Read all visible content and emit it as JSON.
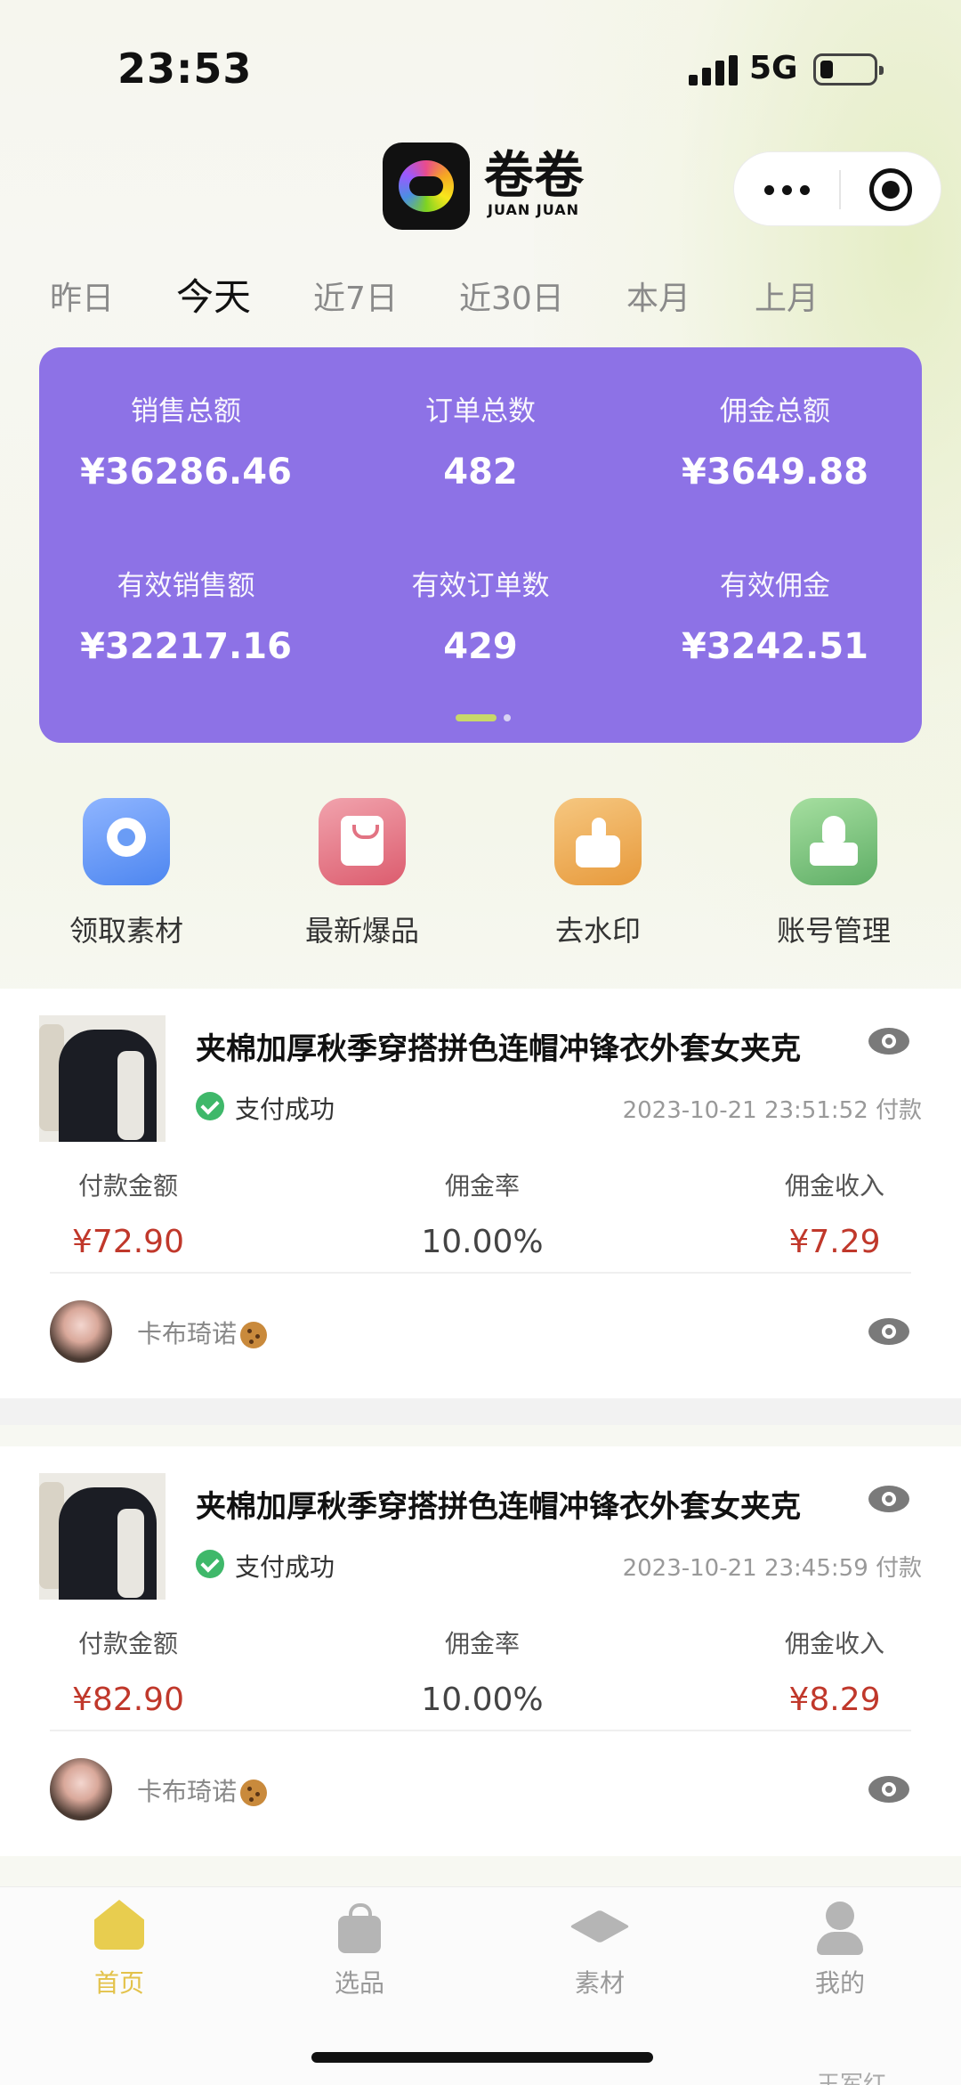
{
  "status_bar": {
    "time": "23:53",
    "network": "5G"
  },
  "header": {
    "app_name": "卷卷",
    "app_name_latin": "JUAN JUAN"
  },
  "tabs": [
    {
      "label": "昨日"
    },
    {
      "label": "今天",
      "active": true
    },
    {
      "label": "近7日"
    },
    {
      "label": "近30日"
    },
    {
      "label": "本月"
    },
    {
      "label": "上月"
    }
  ],
  "stats": [
    {
      "label": "销售总额",
      "value": "¥36286.46"
    },
    {
      "label": "订单总数",
      "value": "482"
    },
    {
      "label": "佣金总额",
      "value": "¥3649.88"
    },
    {
      "label": "有效销售额",
      "value": "¥32217.16"
    },
    {
      "label": "有效订单数",
      "value": "429"
    },
    {
      "label": "有效佣金",
      "value": "¥3242.51"
    }
  ],
  "quick_actions": [
    {
      "label": "领取素材",
      "icon": "material-icon"
    },
    {
      "label": "最新爆品",
      "icon": "shopping-bag-icon"
    },
    {
      "label": "去水印",
      "icon": "thumbs-up-icon"
    },
    {
      "label": "账号管理",
      "icon": "stamp-icon"
    }
  ],
  "orders": [
    {
      "title": "夹棉加厚秋季穿搭拼色连帽冲锋衣外套女夹克",
      "status": "支付成功",
      "paid_time": "2023-10-21 23:51:52 付款",
      "payment_label": "付款金额",
      "payment_amount": "¥72.90",
      "rate_label": "佣金率",
      "rate": "10.00%",
      "income_label": "佣金收入",
      "income": "¥7.29",
      "user_name": "卡布琦诺"
    },
    {
      "title": "夹棉加厚秋季穿搭拼色连帽冲锋衣外套女夹克",
      "status": "支付成功",
      "paid_time": "2023-10-21 23:45:59 付款",
      "payment_label": "付款金额",
      "payment_amount": "¥82.90",
      "rate_label": "佣金率",
      "rate": "10.00%",
      "income_label": "佣金收入",
      "income": "¥8.29",
      "user_name": "卡布琦诺"
    }
  ],
  "bottom_nav": [
    {
      "label": "首页",
      "active": true
    },
    {
      "label": "选品"
    },
    {
      "label": "素材"
    },
    {
      "label": "我的"
    }
  ],
  "watermark": "王军红",
  "colors": {
    "stats_card": "#8d72e6",
    "accent_red": "#c0382b",
    "nav_active": "#e3c24a",
    "success_green": "#3fb86a"
  }
}
